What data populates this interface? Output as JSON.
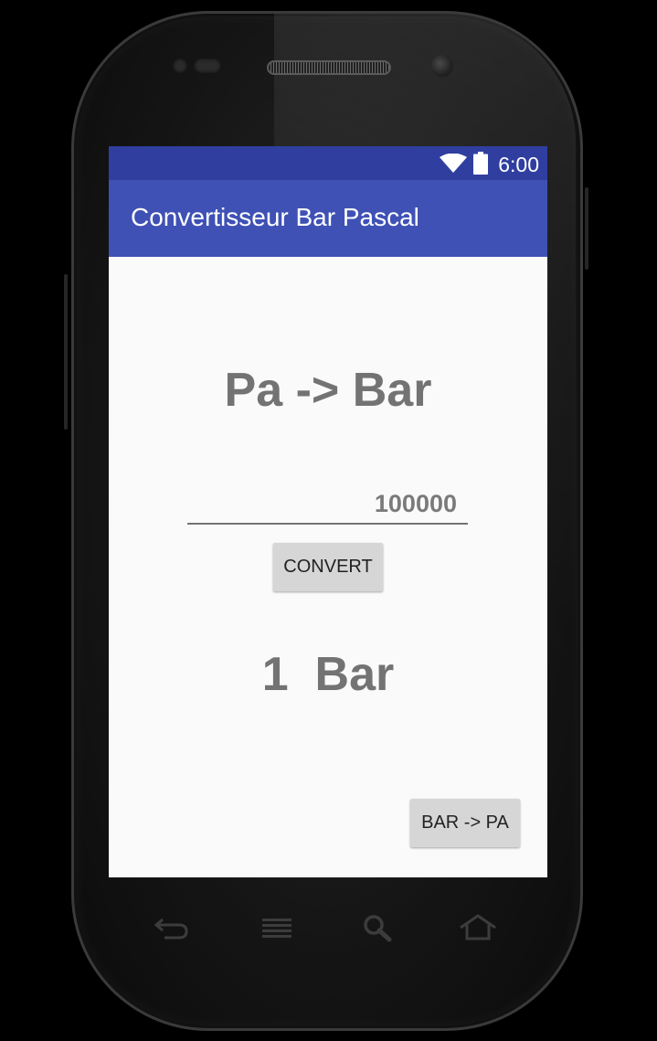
{
  "status_bar": {
    "time": "6:00",
    "icons": [
      "wifi-icon",
      "battery-icon"
    ]
  },
  "app_bar": {
    "title": "Convertisseur Bar Pascal"
  },
  "main": {
    "heading": "Pa -> Bar",
    "input_value": "100000",
    "convert_label": "CONVERT",
    "result_text": "1  Bar",
    "switch_label": "BAR -> PA"
  },
  "hardware_keys": [
    "back-icon",
    "menu-icon",
    "search-icon",
    "home-icon"
  ],
  "colors": {
    "status_bar": "#303f9f",
    "app_bar": "#3f51b5",
    "screen_background": "#fafafa",
    "text_gray": "#737373",
    "button": "#d6d6d6"
  }
}
